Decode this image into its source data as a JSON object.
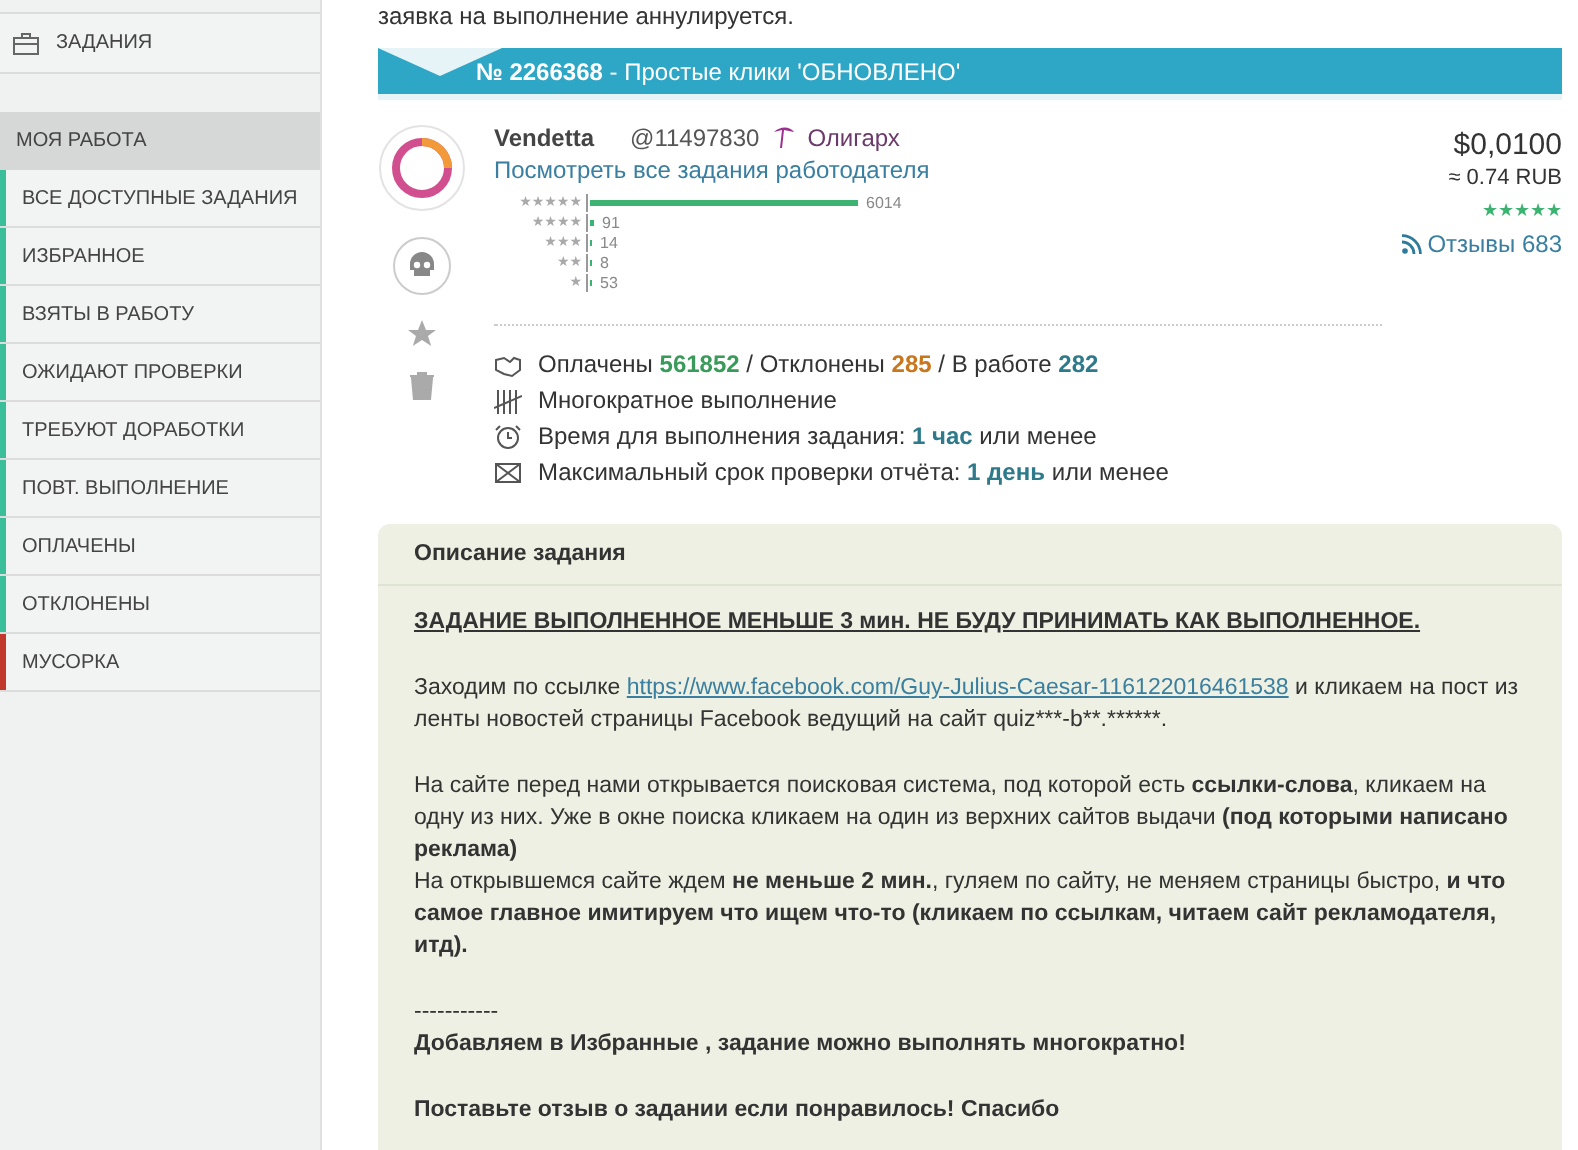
{
  "sidebar": {
    "top_item": {
      "label": "ЗАДАНИЯ"
    },
    "section": {
      "label": "МОЯ РАБОТА"
    },
    "items": [
      {
        "label": "ВСЕ ДОСТУПНЫЕ ЗАДАНИЯ",
        "color": "#3bbf9a"
      },
      {
        "label": "ИЗБРАННОЕ",
        "color": "#3bbf9a"
      },
      {
        "label": "ВЗЯТЫ В РАБОТУ",
        "color": "#3bbf9a"
      },
      {
        "label": "ОЖИДАЮТ ПРОВЕРКИ",
        "color": "#3bbf9a"
      },
      {
        "label": "ТРЕБУЮТ ДОРАБОТКИ",
        "color": "#3bbf9a"
      },
      {
        "label": "ПОВТ. ВЫПОЛНЕНИЕ",
        "color": "#3bbf9a"
      },
      {
        "label": "ОПЛАЧЕНЫ",
        "color": "#3bbf9a"
      },
      {
        "label": "ОТКЛОНЕНЫ",
        "color": "#3bbf9a"
      },
      {
        "label": "МУСОРКА",
        "color": "#c0392b"
      }
    ]
  },
  "intro_text": "заявка на выполнение аннулируется.",
  "task_header": "**№ 2266368** - Простые клики 'ОБНОВЛЕНО'",
  "employer": {
    "name": "Vendetta",
    "id": "@11497830",
    "rank": "Олигарх",
    "link": "Посмотреть все задания работодателя",
    "ratings": [
      {
        "label": "★★★★★",
        "count": "6014"
      },
      {
        "label": "★★★★",
        "count": "91"
      },
      {
        "label": "★★★",
        "count": "14"
      },
      {
        "label": "★★",
        "count": "8"
      },
      {
        "label": "★",
        "count": "53"
      }
    ]
  },
  "price": {
    "usd": "$0,0100",
    "rub": "≈ 0.74 RUB",
    "stars": 5,
    "reviews": "Отзывы 683"
  },
  "stats": [
    {
      "label": "Оплачены",
      "value": "561852",
      "color": "#3a9a5a"
    },
    {
      "separator": "/",
      "label": "Отклонены",
      "value": "285",
      "color": "#c8771e"
    },
    {
      "separator": "/",
      "label": "В работе",
      "value": "282",
      "color": "#2e7a8a"
    }
  ],
  "details": [
    {
      "kind": "repeat",
      "text": "Многократное выполнение"
    },
    {
      "kind": "time",
      "text": "Время для выполнения задания: **1 час** или менее"
    },
    {
      "kind": "check",
      "text": "Максимальный срок проверки отчёта: **1 день** или менее"
    }
  ],
  "description": {
    "title": "Описание задания",
    "paragraphs": [
      {
        "kind": "warning",
        "text": "ЗАДАНИЕ ВЫПОЛНЕННОЕ МЕНЬШЕ 3 мин. НЕ БУДУ ПРИНИМАТЬ КАК ВЫПОЛНЕННОЕ."
      },
      {
        "kind": "link",
        "before": "Заходим по ссылке",
        "link": "https://www.facebook.com/Guy-Julius-Caesar-116122016461538",
        "after": "и кликаем на пост из ленты новостей страницы Facebook ведущий на сайт quiz***-b**.******."
      },
      {
        "kind": "text",
        "text": "На сайте перед нами открывается поисковая система, под которой есть **ссылки-слова**, кликаем на одну из них. Уже в окне поиска кликаем на один из верхних сайтов выдачи **(под которыми написано реклама)**"
      },
      {
        "kind": "text_tight",
        "text": "На открывшемся сайте ждем **не меньше 2 мин.**, гуляем по сайту, не меняем страницы быстро, **и что самое главное имитируем что ищем что-то (кликаем по ссылкам, читаем сайт рекламодателя, итд).**"
      },
      {
        "kind": "separator",
        "text": "-----------"
      },
      {
        "kind": "bold_tight",
        "text": "Добавляем в Избранные , задание можно выполнять многократно!"
      },
      {
        "kind": "bold",
        "text": "Поставьте отзыв о задании если понравилось! Спасибо"
      }
    ]
  }
}
